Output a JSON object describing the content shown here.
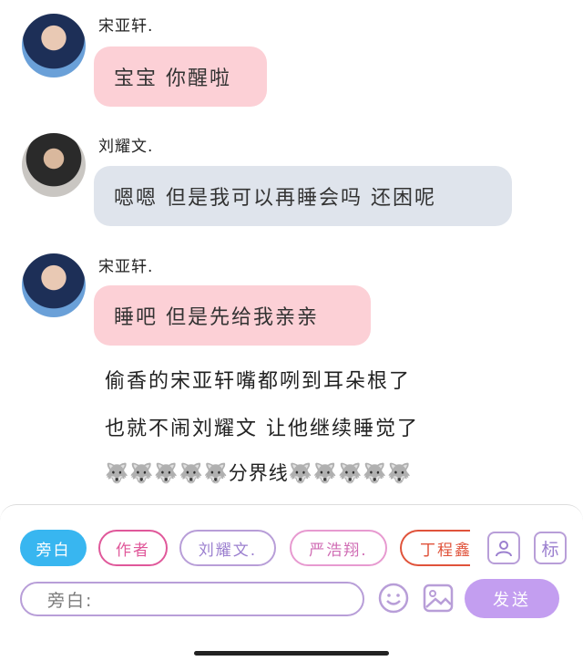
{
  "messages": [
    {
      "speaker": "宋亚轩.",
      "text": "宝宝 你醒啦",
      "bubble": "pink"
    },
    {
      "speaker": "刘耀文.",
      "text": "嗯嗯 但是我可以再睡会吗 还困呢",
      "bubble": "gray"
    },
    {
      "speaker": "宋亚轩.",
      "text": "睡吧 但是先给我亲亲",
      "bubble": "pink"
    }
  ],
  "narration": [
    "偷香的宋亚轩嘴都咧到耳朵根了",
    "也就不闹刘耀文 让他继续睡觉了",
    "🐺🐺🐺🐺🐺分界线🐺🐺🐺🐺🐺"
  ],
  "composer": {
    "roles": [
      "旁白",
      "作者",
      "刘耀文.",
      "严浩翔.",
      "丁程鑫"
    ],
    "selected_role": "旁白",
    "profile_icon": "person-card-icon",
    "tag_label": "标",
    "input_value": "旁白:",
    "emoji_icon": "smiley-icon",
    "image_icon": "image-icon",
    "send_label": "发送"
  },
  "colors": {
    "pink_bubble": "#fcd0d6",
    "gray_bubble": "#dfe4ec",
    "accent_blue": "#38b6f0",
    "accent_purple": "#c39ef0",
    "chip_pink": "#e0589a",
    "chip_red": "#e0533b"
  }
}
